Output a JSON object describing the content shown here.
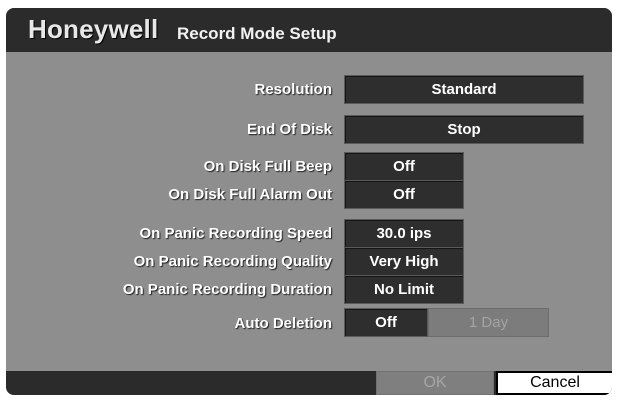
{
  "header": {
    "brand": "Honeywell",
    "title": "Record Mode Setup"
  },
  "settings": {
    "resolution": {
      "label": "Resolution",
      "value": "Standard"
    },
    "end_of_disk": {
      "label": "End Of Disk",
      "value": "Stop"
    },
    "disk_full_beep": {
      "label": "On Disk Full Beep",
      "value": "Off"
    },
    "disk_full_alarm": {
      "label": "On Disk Full Alarm Out",
      "value": "Off"
    },
    "panic_speed": {
      "label": "On Panic Recording Speed",
      "value": "30.0 ips"
    },
    "panic_quality": {
      "label": "On Panic Recording Quality",
      "value": "Very High"
    },
    "panic_duration": {
      "label": "On Panic Recording Duration",
      "value": "No Limit"
    },
    "auto_deletion": {
      "label": "Auto Deletion",
      "value": "Off",
      "period": "1 Day"
    }
  },
  "buttons": {
    "ok": "OK",
    "cancel": "Cancel"
  }
}
